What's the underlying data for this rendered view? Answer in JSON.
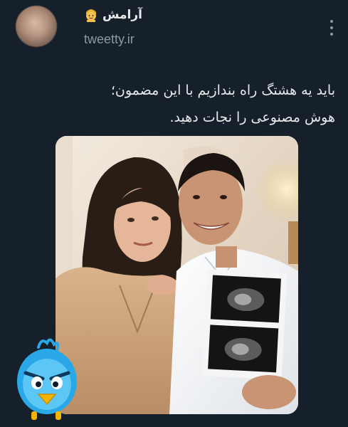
{
  "tweet": {
    "author": {
      "display_name": "آرامش",
      "emoji": "blond-person-emoji-icon",
      "handle": "tweetty.ir"
    },
    "text_lines": [
      "باید یه هشتگ راه بندازیم با این مضمون؛",
      "هوش مصنوعی را نجات دهید."
    ],
    "media": {
      "kind": "photo",
      "subject": "couple-holding-ultrasound-photo"
    },
    "sticker": "angry-blue-bird-icon"
  },
  "colors": {
    "background": "#15202b",
    "text": "#e7e9ea",
    "secondary_text": "#8b98a5"
  }
}
